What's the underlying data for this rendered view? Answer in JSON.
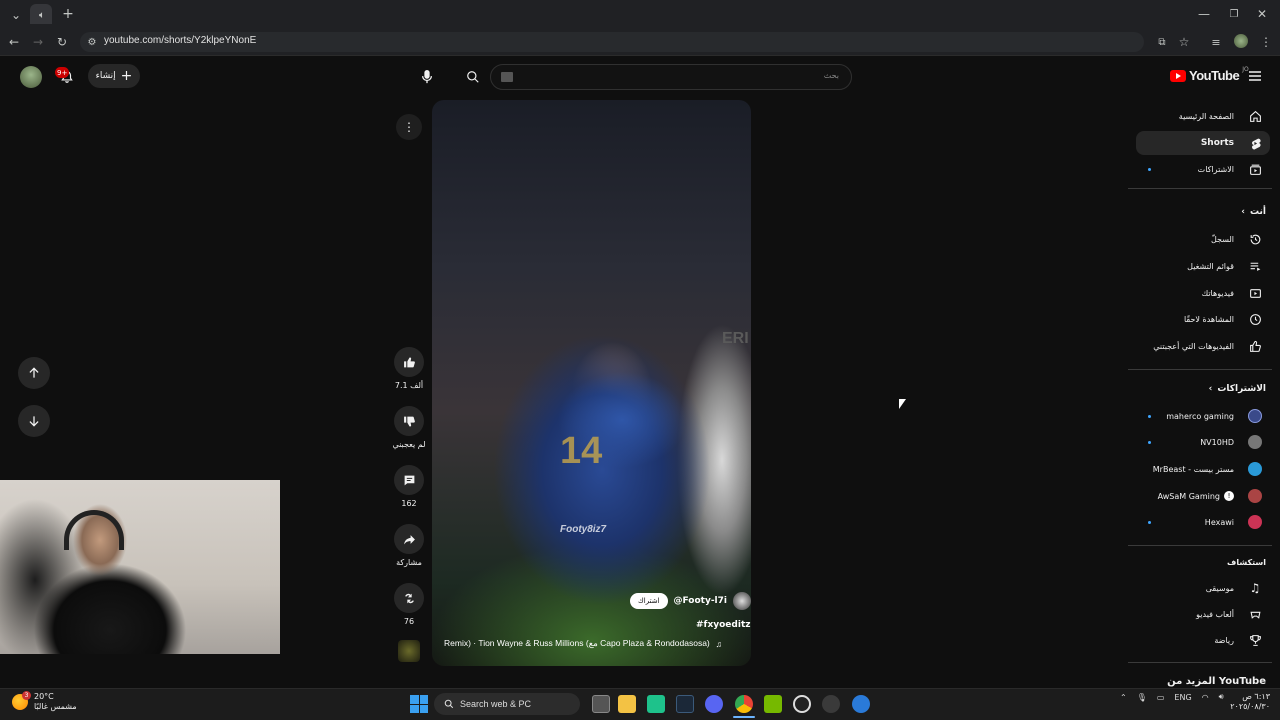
{
  "browser": {
    "url": "youtube.com/shorts/Y2klpeYNonE"
  },
  "header": {
    "search_placeholder": "بحث",
    "create_label": "إنشاء",
    "notifications_count": "9+",
    "logo_text": "YouTube",
    "logo_country": "JO"
  },
  "sidebar": {
    "primary": [
      {
        "label": "الصفحة الرئيسية",
        "icon": "home-icon"
      },
      {
        "label": "Shorts",
        "icon": "shorts-icon",
        "active": true
      },
      {
        "label": "الاشتراكات",
        "icon": "subscriptions-icon"
      }
    ],
    "you_heading": "أنت",
    "you_items": [
      {
        "label": "السجلّ",
        "icon": "history-icon"
      },
      {
        "label": "قوائم التشغيل",
        "icon": "playlists-icon"
      },
      {
        "label": "فيديوهاتك",
        "icon": "your-videos-icon"
      },
      {
        "label": "المشاهدة لاحقًا",
        "icon": "watch-later-icon"
      },
      {
        "label": "الفيديوهات التي أعجبتني",
        "icon": "liked-videos-icon"
      }
    ],
    "subs_heading": "الاشتراكات",
    "subscriptions": [
      {
        "label": "maherco gaming",
        "color": "#3a4a8a"
      },
      {
        "label": "NV10HD",
        "color": "#888888"
      },
      {
        "label": "MrBeast - مستر بيست",
        "color": "#2a9ad8"
      },
      {
        "label": "AwSaM Gaming",
        "color": "#aa4444"
      },
      {
        "label": "Hexawi",
        "color": "#cc3355"
      }
    ],
    "explore_heading": "استكشاف",
    "explore_items": [
      {
        "label": "موسيقى",
        "icon": "music-icon"
      },
      {
        "label": "ألعاب فيديو",
        "icon": "gaming-icon"
      },
      {
        "label": "رياضة",
        "icon": "trophy-icon"
      }
    ],
    "more_heading": "المزيد من YouTube"
  },
  "short": {
    "likes": "7.1 ألف",
    "dislike_label": "لم يعجبني",
    "comments": "162",
    "share_label": "مشاركة",
    "remix_count": "76",
    "subscribe_label": "اشتراك",
    "channel": "@Footy-l7i",
    "hashtag": "#fxyoeditz",
    "music": "Remix) · Tion Wayne & Russ Millions (مع Capo Plaza & Rondodasosa)",
    "watermark": "Footy8iz7",
    "jersey_number": "14",
    "shirt_text": "ERI"
  },
  "taskbar": {
    "weather_temp": "20°C",
    "weather_desc": "مشمس غالبًا",
    "weather_badge": "3",
    "search_placeholder": "Search web & PC",
    "lang": "ENG",
    "time": "٦:١٣ ص",
    "date": "٢٠٢٥/٠٨/٣٠"
  }
}
